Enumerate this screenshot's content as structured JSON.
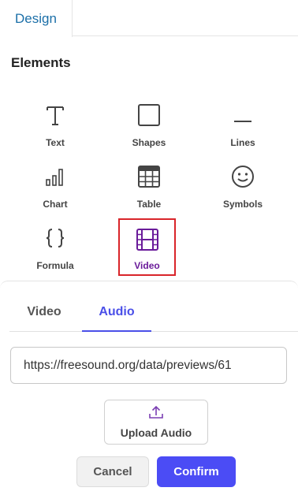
{
  "header": {
    "tab_label": "Design"
  },
  "elements_section": {
    "title": "Elements",
    "items": [
      {
        "label": "Text",
        "icon": "text-icon"
      },
      {
        "label": "Shapes",
        "icon": "square-icon"
      },
      {
        "label": "Lines",
        "icon": "line-icon"
      },
      {
        "label": "Chart",
        "icon": "chart-icon"
      },
      {
        "label": "Table",
        "icon": "table-icon"
      },
      {
        "label": "Symbols",
        "icon": "smiley-icon"
      },
      {
        "label": "Formula",
        "icon": "braces-icon"
      },
      {
        "label": "Video",
        "icon": "film-icon",
        "selected": true
      }
    ]
  },
  "media_panel": {
    "tabs": [
      {
        "label": "Video",
        "active": false
      },
      {
        "label": "Audio",
        "active": true
      }
    ],
    "url_value": "https://freesound.org/data/previews/61",
    "upload_label": "Upload Audio",
    "cancel_label": "Cancel",
    "confirm_label": "Confirm"
  },
  "colors": {
    "accent": "#4b4cf5",
    "selection_border": "#d9252a",
    "video_icon": "#6a1b9a",
    "tab_text": "#1b6fa8"
  }
}
